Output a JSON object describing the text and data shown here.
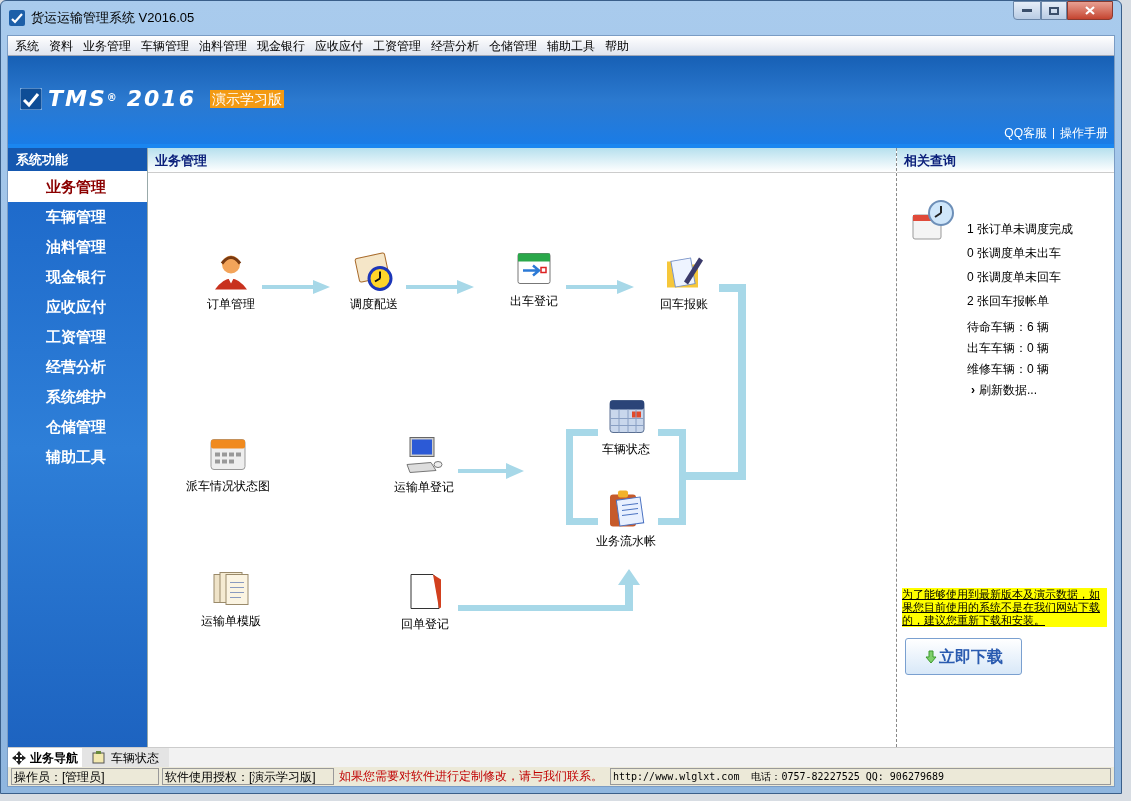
{
  "window": {
    "title": "货运运输管理系统 V2016.05"
  },
  "menu": [
    "系统",
    "资料",
    "业务管理",
    "车辆管理",
    "油料管理",
    "现金银行",
    "应收应付",
    "工资管理",
    "经营分析",
    "仓储管理",
    "辅助工具",
    "帮助"
  ],
  "banner": {
    "logo": "TMS",
    "logo_mark": "®",
    "year": "2016",
    "edition": "演示学习版",
    "links": [
      "QQ客服",
      "操作手册"
    ]
  },
  "sidebar": {
    "title": "系统功能",
    "items": [
      {
        "label": "业务管理",
        "selected": true
      },
      {
        "label": "车辆管理",
        "selected": false
      },
      {
        "label": "油料管理",
        "selected": false
      },
      {
        "label": "现金银行",
        "selected": false
      },
      {
        "label": "应收应付",
        "selected": false
      },
      {
        "label": "工资管理",
        "selected": false
      },
      {
        "label": "经营分析",
        "selected": false
      },
      {
        "label": "系统维护",
        "selected": false
      },
      {
        "label": "仓储管理",
        "selected": false
      },
      {
        "label": "辅助工具",
        "selected": false
      }
    ]
  },
  "workflow": {
    "title": "业务管理",
    "nodes": [
      {
        "label": "订单管理",
        "kind": "operator"
      },
      {
        "label": "调度配送",
        "kind": "dispatch"
      },
      {
        "label": "出车登记",
        "kind": "departure"
      },
      {
        "label": "回车报账",
        "kind": "report"
      },
      {
        "label": "派车情况状态图",
        "kind": "calendar"
      },
      {
        "label": "运输单登记",
        "kind": "computer"
      },
      {
        "label": "车辆状态",
        "kind": "schedule"
      },
      {
        "label": "业务流水帐",
        "kind": "clipboard"
      },
      {
        "label": "运输单模版",
        "kind": "documents"
      },
      {
        "label": "回单登记",
        "kind": "blank"
      }
    ]
  },
  "related": {
    "title": "相关查询",
    "counts": [
      "1 张订单未调度完成",
      "0 张调度单未出车",
      "0 张调度单未回车",
      "2 张回车报帐单"
    ],
    "vehicles": [
      "待命车辆：6 辆",
      "出车车辆：0 辆",
      "维修车辆：0 辆"
    ],
    "refresh_mark": "›",
    "refresh": "刷新数据...",
    "notice": "为了能够使用到最新版本及演示数据，如果您目前使用的系统不是在我们网站下载的，建议您重新下载和安装。",
    "download": "立即下载"
  },
  "bottom_tabs": [
    {
      "label": "业务导航",
      "selected": true
    },
    {
      "label": "车辆状态",
      "selected": false
    }
  ],
  "status_bar": [
    {
      "text": "操作员：[管理员]",
      "kind": "plain"
    },
    {
      "text": "软件使用授权：[演示学习版]",
      "kind": "plain"
    },
    {
      "text": "如果您需要对软件进行定制修改，请与我们联系。",
      "kind": "alert"
    },
    {
      "text": "http://www.wlglxt.com  电话：0757-82227525 QQ: 906279689",
      "kind": "mono"
    }
  ]
}
